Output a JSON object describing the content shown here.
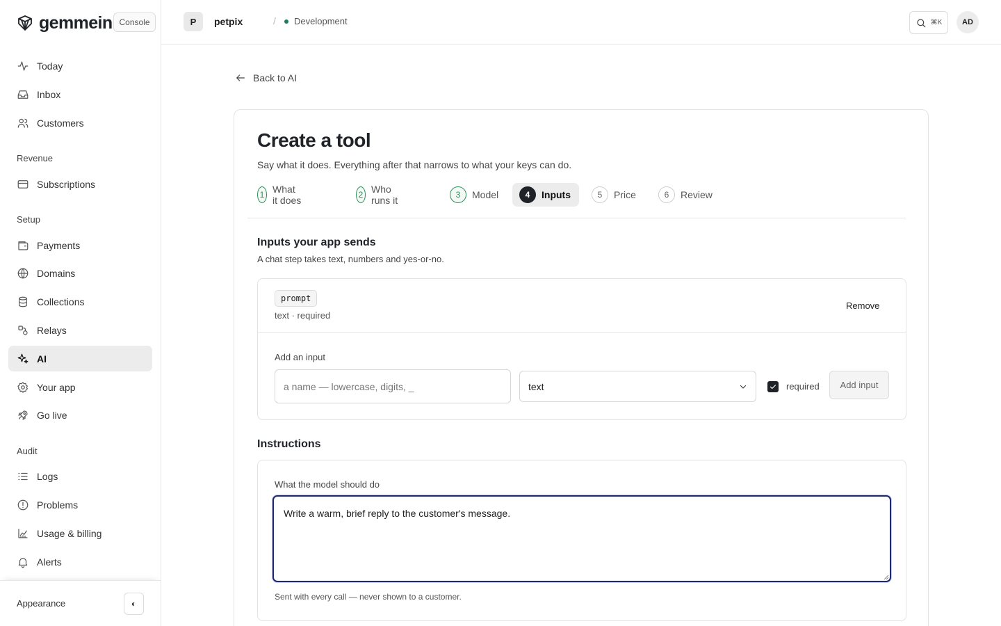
{
  "brand": {
    "name": "gemmein",
    "badge": "Console"
  },
  "nav": {
    "top_items": [
      {
        "label": "Today",
        "icon": "activity-icon"
      },
      {
        "label": "Inbox",
        "icon": "inbox-icon"
      },
      {
        "label": "Customers",
        "icon": "users-icon"
      }
    ],
    "sections": [
      {
        "label": "Revenue",
        "items": [
          {
            "label": "Subscriptions",
            "icon": "credit-card-icon"
          }
        ]
      },
      {
        "label": "Setup",
        "items": [
          {
            "label": "Payments",
            "icon": "wallet-icon"
          },
          {
            "label": "Domains",
            "icon": "globe-icon"
          },
          {
            "label": "Collections",
            "icon": "database-icon"
          },
          {
            "label": "Relays",
            "icon": "relay-icon"
          },
          {
            "label": "AI",
            "icon": "sparkles-icon",
            "active": true
          },
          {
            "label": "Your app",
            "icon": "gear-icon"
          },
          {
            "label": "Go live",
            "icon": "rocket-icon"
          }
        ]
      },
      {
        "label": "Audit",
        "items": [
          {
            "label": "Logs",
            "icon": "list-icon"
          },
          {
            "label": "Problems",
            "icon": "alert-circle-icon"
          },
          {
            "label": "Usage & billing",
            "icon": "chart-icon"
          },
          {
            "label": "Alerts",
            "icon": "bell-icon"
          }
        ]
      }
    ],
    "footer": {
      "appearance_label": "Appearance",
      "toggle_glyph": "◐"
    }
  },
  "topbar": {
    "project_initial": "P",
    "project_name": "petpix",
    "separator": "/",
    "environment": "Development",
    "search_shortcut": "⌘K",
    "user_initials": "AD"
  },
  "page": {
    "back_label": "Back to AI",
    "title": "Create a tool",
    "subtitle": "Say what it does. Everything after that narrows to what your keys can do.",
    "steps": [
      {
        "num": "1",
        "label": "What it does",
        "state": "done"
      },
      {
        "num": "2",
        "label": "Who runs it",
        "state": "done"
      },
      {
        "num": "3",
        "label": "Model",
        "state": "done"
      },
      {
        "num": "4",
        "label": "Inputs",
        "state": "current"
      },
      {
        "num": "5",
        "label": "Price",
        "state": "todo"
      },
      {
        "num": "6",
        "label": "Review",
        "state": "todo"
      }
    ]
  },
  "inputs_section": {
    "title": "Inputs your app sends",
    "description": "A chat step takes text, numbers and yes-or-no.",
    "existing": [
      {
        "name": "prompt",
        "meta": "text · required",
        "remove_label": "Remove"
      }
    ],
    "add": {
      "label": "Add an input",
      "name_placeholder": "a name — lowercase, digits, _",
      "type_value": "text",
      "required_checked": true,
      "required_label": "required",
      "add_button": "Add input"
    }
  },
  "instructions_section": {
    "title": "Instructions",
    "field_label": "What the model should do",
    "value": "Write a warm, brief reply to the customer's message.",
    "help": "Sent with every call — never shown to a customer."
  },
  "colors": {
    "accent": "#1e2a6e",
    "success": "#2f8f5b",
    "active_bg": "#ececec"
  }
}
